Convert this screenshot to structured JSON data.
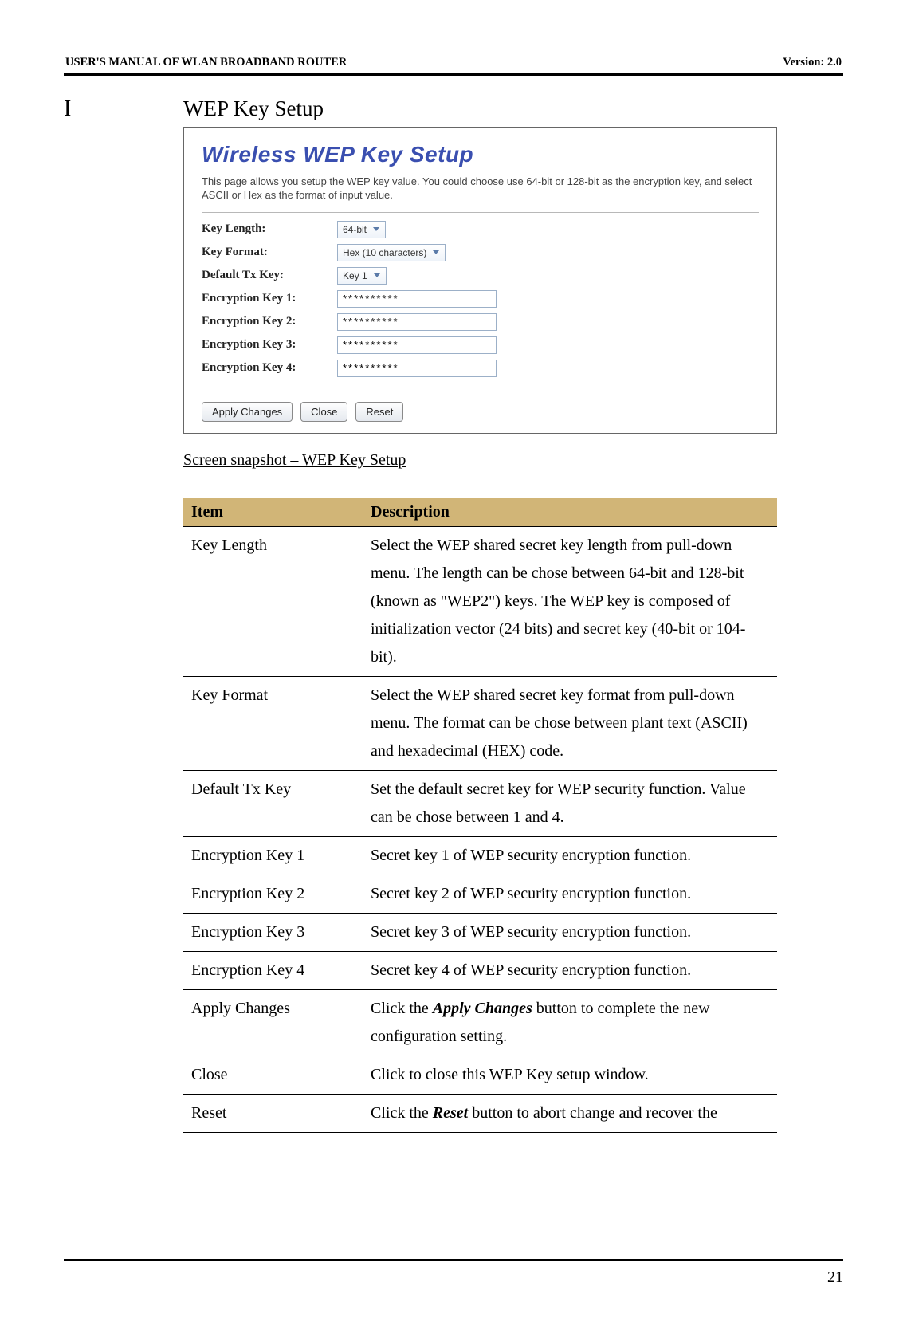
{
  "header": {
    "left": "USER'S MANUAL OF WLAN BROADBAND ROUTER",
    "right": "Version: 2.0"
  },
  "section": {
    "letter": "I",
    "title": "WEP Key Setup"
  },
  "screenshot": {
    "title": "Wireless WEP Key Setup",
    "description": "This page allows you setup the WEP key value. You could choose use 64-bit or 128-bit as the encryption key, and select ASCII or Hex as the format of input value.",
    "rows": {
      "key_length": {
        "label": "Key Length:",
        "value": "64-bit"
      },
      "key_format": {
        "label": "Key Format:",
        "value": "Hex (10 characters)"
      },
      "default_tx": {
        "label": "Default Tx Key:",
        "value": "Key 1"
      },
      "enc1": {
        "label": "Encryption Key 1:",
        "value": "**********"
      },
      "enc2": {
        "label": "Encryption Key 2:",
        "value": "**********"
      },
      "enc3": {
        "label": "Encryption Key 3:",
        "value": "**********"
      },
      "enc4": {
        "label": "Encryption Key 4:",
        "value": "**********"
      }
    },
    "buttons": {
      "apply": "Apply Changes",
      "close": "Close",
      "reset": "Reset"
    }
  },
  "caption": "Screen snapshot – WEP Key Setup",
  "table": {
    "head": {
      "item": "Item",
      "desc": "Description"
    },
    "rows": [
      {
        "item": "Key Length",
        "desc": "Select the WEP shared secret key length from pull-down menu. The length can be chose between 64-bit and 128-bit (known as \"WEP2\") keys.\nThe WEP key is composed of initialization vector (24 bits) and secret key (40-bit or 104-bit)."
      },
      {
        "item": "Key Format",
        "desc": "Select the WEP shared secret key format from pull-down menu. The format can be chose between plant text (ASCII) and hexadecimal (HEX) code."
      },
      {
        "item": "Default Tx Key",
        "desc": "Set the default secret key for WEP security function. Value can be chose between 1 and 4."
      },
      {
        "item": "Encryption Key 1",
        "desc": "Secret key 1 of WEP security encryption function."
      },
      {
        "item": "Encryption Key 2",
        "desc": "Secret key 2 of WEP security encryption function."
      },
      {
        "item": "Encryption Key 3",
        "desc": "Secret key 3 of WEP security encryption function."
      },
      {
        "item": "Encryption Key 4",
        "desc": "Secret key 4 of WEP security encryption function."
      },
      {
        "item": "Apply Changes",
        "desc_pre": "Click the ",
        "desc_bi": "Apply Changes",
        "desc_post": " button to complete the new configuration setting."
      },
      {
        "item": "Close",
        "desc": "Click to close this WEP Key setup window."
      },
      {
        "item": "Reset",
        "desc_pre": "Click the ",
        "desc_bi": "Reset",
        "desc_post": " button to abort change and recover the"
      }
    ]
  },
  "page_number": "21"
}
